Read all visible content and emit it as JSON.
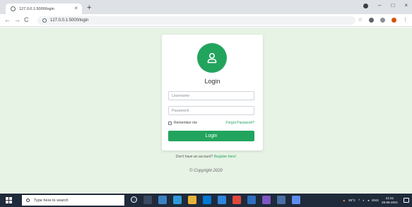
{
  "browser": {
    "tab_title": "127.0.0.1:5000/login",
    "tab_close": "×",
    "new_tab": "+",
    "url": "127.0.0.1:5000/login",
    "back": "←",
    "forward": "→",
    "reload": "C",
    "minimize": "–",
    "maximize": "□",
    "close": "×",
    "bookmark_star": "☆",
    "menu": "⋮"
  },
  "login": {
    "title": "Login",
    "username_placeholder": "Username",
    "password_placeholder": "Password",
    "remember_label": "Remember me",
    "forgot_label": "Forgot Password?",
    "submit_label": "Login",
    "register_prompt": "Don't have an account?",
    "register_link": "Register here!",
    "copyright": "© Copyright 2020"
  },
  "taskbar": {
    "search_placeholder": "Type here to search",
    "weather": "28°C",
    "language": "ENG",
    "time": "21:51",
    "date": "28-06-2021"
  },
  "colors": {
    "accent": "#22a45d",
    "page_background": "#e7f3e5",
    "taskbar": "#1f2a3a"
  }
}
